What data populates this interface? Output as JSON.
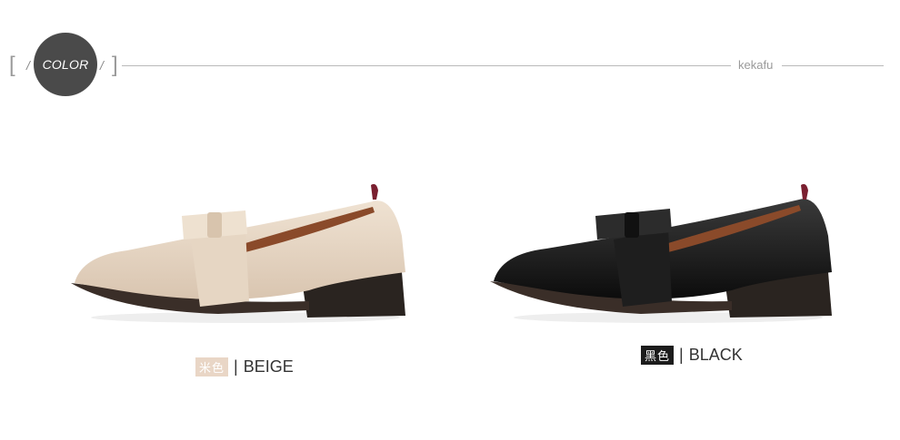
{
  "header": {
    "badge_label": "COLOR",
    "brand": "kekafu"
  },
  "variants": [
    {
      "tag": "米色",
      "name": "BEIGE",
      "tag_color": "#e9d6c6"
    },
    {
      "tag": "黑色",
      "name": "BLACK",
      "tag_color": "#1c1c1c"
    }
  ],
  "colors": {
    "badge": "#4a4a4a",
    "rule": "#b9b9b9"
  }
}
